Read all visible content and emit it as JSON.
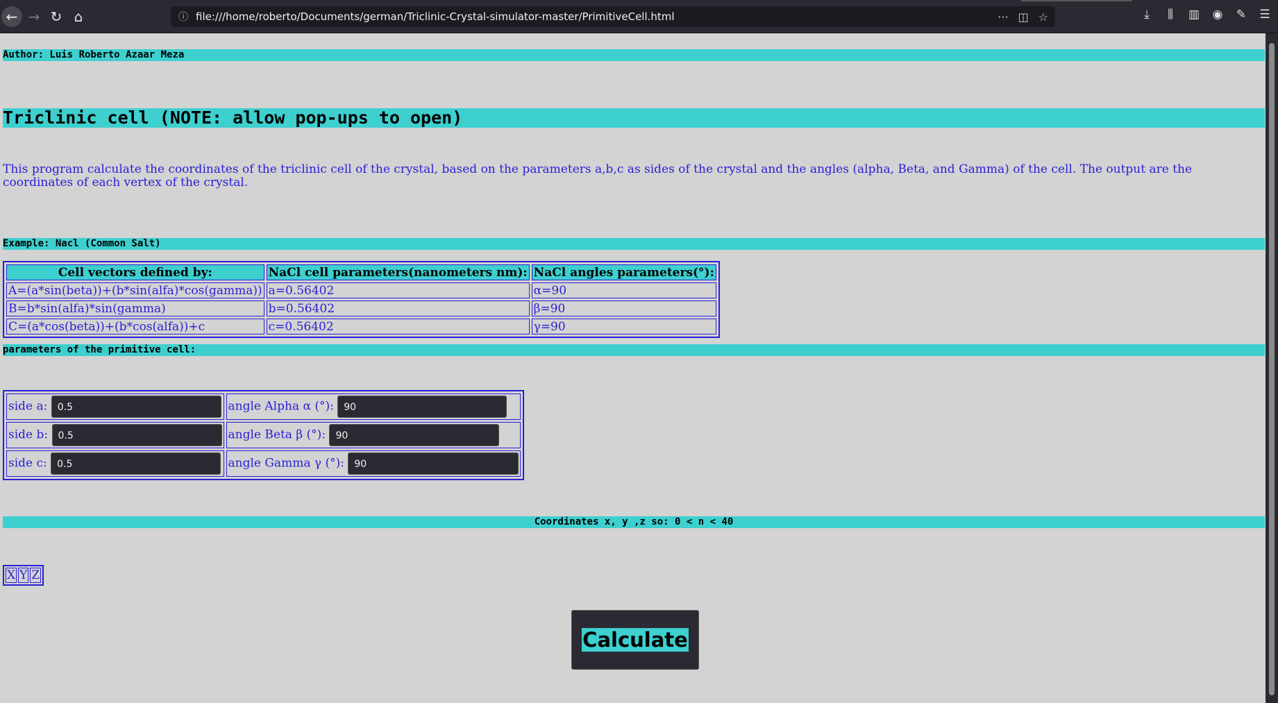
{
  "browser": {
    "url": "file:///home/roberto/Documents/german/Triclinic-Crystal-simulator-master/PrimitiveCell.html"
  },
  "page": {
    "author": "Author: Luis Roberto Azaar Meza",
    "title": "Triclinic cell (NOTE: allow pop-ups to open)",
    "description": "This program calculate the coordinates of the triclinic cell of the crystal, based on the parameters a,b,c as sides of the crystal and the angles (alpha, Beta, and Gamma) of the cell. The output are the coordinates of each vertex of the crystal.",
    "example_header": "Example: Nacl (Common Salt)",
    "example_table": {
      "headers": [
        "Cell vectors defined by:",
        "NaCl cell parameters(nanometers nm):",
        "NaCl angles parameters(°):"
      ],
      "rows": [
        [
          "A=(a*sin(beta))+(b*sin(alfa)*cos(gamma))",
          "a=0.56402",
          "α=90"
        ],
        [
          "B=b*sin(alfa)*sin(gamma)",
          "b=0.56402",
          "β=90"
        ],
        [
          "C=(a*cos(beta))+(b*cos(alfa))+c",
          "c=0.56402",
          "γ=90"
        ]
      ]
    },
    "params_header": "parameters of the primitive cell:",
    "inputs": {
      "side_a_label": "side a:",
      "side_a_value": "0.5",
      "side_b_label": "side b:",
      "side_b_value": "0.5",
      "side_c_label": "side c:",
      "side_c_value": "0.5",
      "alpha_label": "angle Alpha α (°):",
      "alpha_value": "90",
      "beta_label": "angle Beta β (°):",
      "beta_value": "90",
      "gamma_label": "angle Gamma γ (°):",
      "gamma_value": "90"
    },
    "coords_header": "Coordinates x, y ,z so: 0 < n < 40",
    "xyz": [
      "X",
      "Y",
      "Z"
    ],
    "calculate_label": "Calculate"
  },
  "colors": {
    "accent": "#3ecfcf",
    "text": "#2a1fd6",
    "background": "#d3d3d3"
  }
}
